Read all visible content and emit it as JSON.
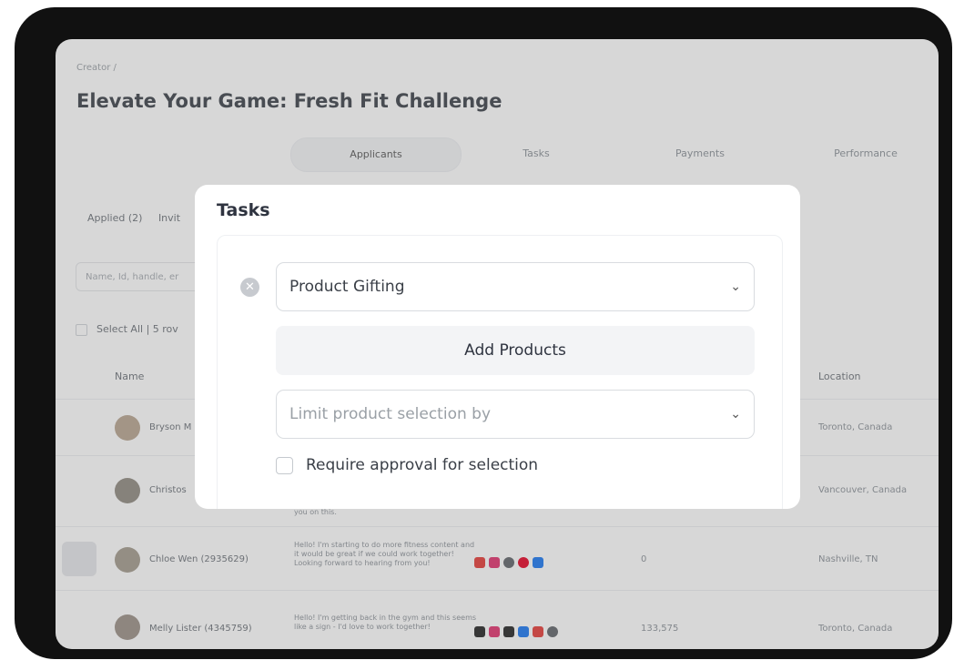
{
  "breadcrumb": "Creator /",
  "title": "Elevate Your Game: Fresh Fit Challenge",
  "tabs": [
    "Applicants",
    "Tasks",
    "Payments",
    "Performance"
  ],
  "subtabs": [
    "Applied (2)",
    "Invit"
  ],
  "search_placeholder": "Name, Id, handle, er",
  "select_all": "Select All  |  5 rov",
  "columns": {
    "name": "Name",
    "location": "Location"
  },
  "rows": [
    {
      "name": "Bryson M",
      "message": "",
      "number": "",
      "location": "Toronto, Canada"
    },
    {
      "name": "Christos",
      "message": "you on this.",
      "number": "",
      "location": "Vancouver, Canada"
    },
    {
      "name": "Chloe Wen (2935629)",
      "message": "Hello! I'm starting to do more fitness content and it would be great if we could work together! Looking forward to hearing from you!",
      "number": "0",
      "location": "Nashville, TN"
    },
    {
      "name": "Melly Lister (4345759)",
      "message": "Hello! I'm getting back in the gym and this seems like a sign - I'd love to work together!",
      "number": "133,575",
      "location": "Toronto, Canada"
    }
  ],
  "modal": {
    "title": "Tasks",
    "task_type": "Product Gifting",
    "add_products": "Add Products",
    "limit_placeholder": "Limit product selection by",
    "require_approval": "Require approval for selection"
  },
  "colors": {
    "social_youtube": "#e53935",
    "social_instagram": "#e1306c",
    "social_web": "#5f6368",
    "social_pinterest": "#e60023",
    "social_facebook": "#1877f2",
    "social_tiktok": "#222222"
  },
  "icons": [
    "remove-circle-icon",
    "chevron-down-icon",
    "youtube-icon",
    "instagram-icon",
    "globe-icon",
    "pinterest-icon",
    "facebook-icon",
    "tiktok-icon"
  ]
}
